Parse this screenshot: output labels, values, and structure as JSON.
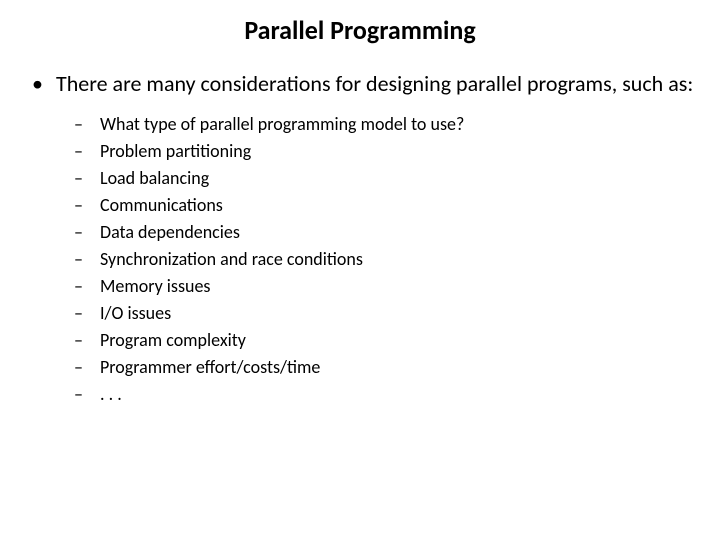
{
  "title": "Parallel Programming",
  "main_bullet": "There are many considerations for designing parallel programs, such as:",
  "sub_items": [
    "What type of parallel programming model to use?",
    "Problem partitioning",
    "Load balancing",
    "Communications",
    "Data dependencies",
    "Synchronization and race conditions",
    "Memory issues",
    "I/O issues",
    "Program complexity",
    "Programmer effort/costs/time",
    ". . ."
  ]
}
